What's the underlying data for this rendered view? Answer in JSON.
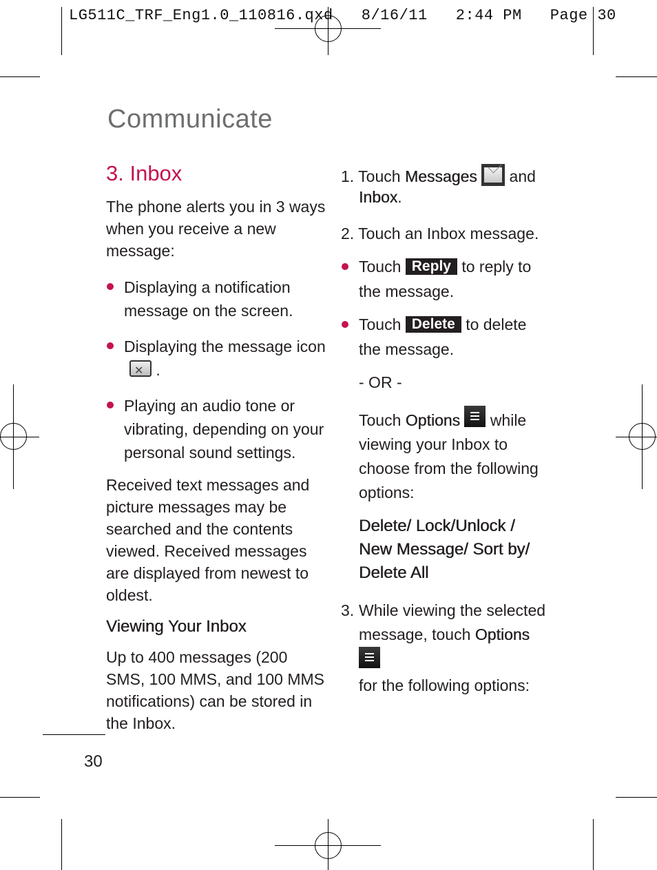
{
  "slug_line": "LG511C_TRF_Eng1.0_110816.qxd   8/16/11   2:44 PM   Page 30",
  "section_title": "Communicate",
  "heading": "3. Inbox",
  "left": {
    "intro": "The phone alerts you in 3 ways when you receive a new message:",
    "bullets": [
      "Displaying a notification message on the screen.",
      "Displaying the message icon",
      "Playing an audio tone or vibrating, depending on your personal sound settings."
    ],
    "bullet2_suffix": ".",
    "para": "Received text messages and picture messages may be searched and the contents viewed. Received messages are displayed from newest to oldest.",
    "subheading": "Viewing Your Inbox",
    "capacity": "Up to 400 messages (200 SMS, 100 MMS, and 100 MMS notifications) can be stored in the Inbox."
  },
  "right": {
    "step1": {
      "num": "1.",
      "pre": "Touch ",
      "b1": "Messages",
      "mid": " and",
      "b2": "Inbox",
      "post": "."
    },
    "step2": "2. Touch an Inbox message.",
    "reply": {
      "pre": "Touch",
      "key": "Reply",
      "post": "to reply to the message."
    },
    "delete": {
      "pre": "Touch",
      "key": "Delete",
      "post": "to delete the message."
    },
    "or": "- OR -",
    "options": {
      "pre": "Touch ",
      "b": "Options",
      "post": " while viewing your Inbox to choose from the following options:"
    },
    "option_list": "Delete/ Lock/Unlock / New Message/ Sort by/ Delete All",
    "step3": {
      "num": "3.",
      "pre": "While viewing the selected message, touch ",
      "b": "Options",
      "post": "for the following options:"
    }
  },
  "page_number": "30"
}
